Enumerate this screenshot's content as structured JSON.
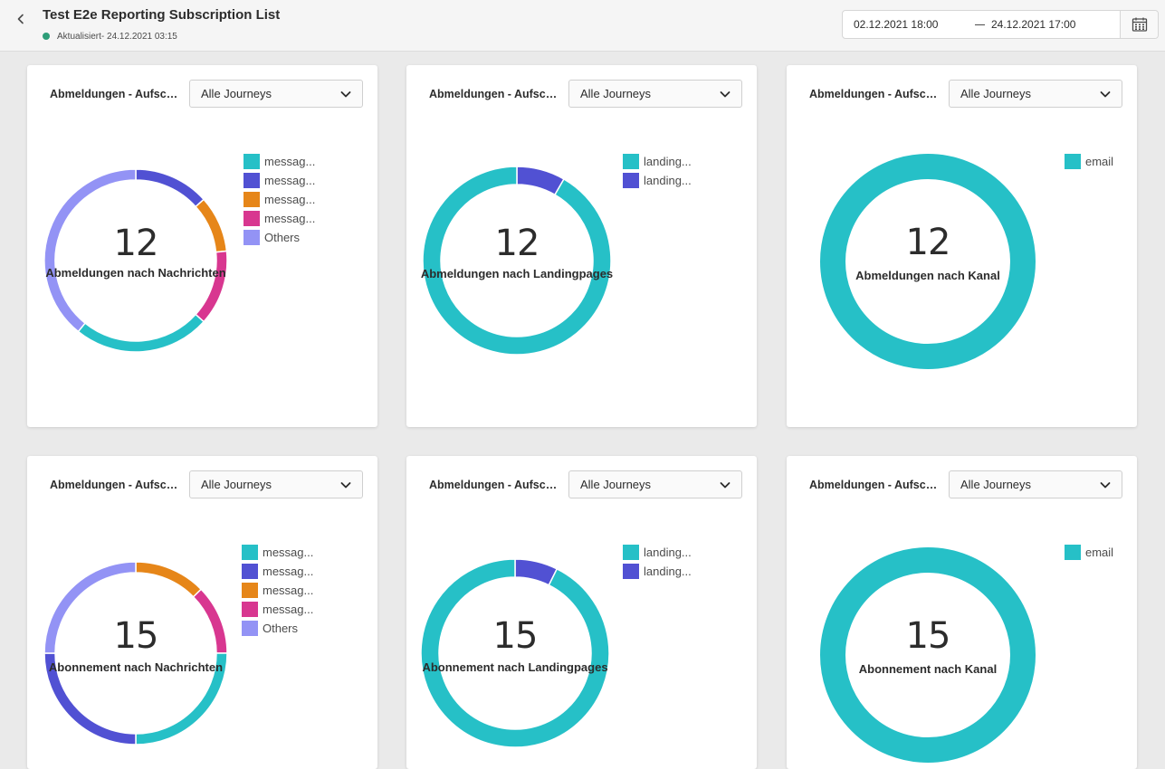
{
  "header": {
    "title": "Test E2e Reporting Subscription List",
    "status": "Aktualisiert- 24.12.2021 03:15",
    "status_color": "#2d9d78",
    "back_icon": "chevron-left-icon"
  },
  "date_range": {
    "start": "02.12.2021 18:00",
    "end": "24.12.2021 17:00",
    "calendar_icon": "calendar-icon"
  },
  "colors": {
    "teal": "#26c0c7",
    "indigo": "#5151d3",
    "orange": "#e68619",
    "magenta": "#d83790",
    "lavender": "#9393f5"
  },
  "cards": [
    {
      "title": "Abmeldungen - Aufschlüsselung",
      "dropdown": "Alle Journeys",
      "chart_data": {
        "type": "pie",
        "total": "12",
        "center_label": "Abmeldungen nach Nachrichten",
        "slices": [
          {
            "label": "messag...",
            "value": 1.6,
            "color": "#5151d3"
          },
          {
            "label": "messag...",
            "value": 1.2,
            "color": "#e68619"
          },
          {
            "label": "messag...",
            "value": 1.6,
            "color": "#d83790"
          },
          {
            "label": "",
            "value": 2.9,
            "color": "#26c0c7"
          },
          {
            "label": "Others",
            "value": 4.7,
            "color": "#9393f5"
          }
        ],
        "legend": [
          {
            "label": "messag...",
            "color": "#26c0c7"
          },
          {
            "label": "messag...",
            "color": "#5151d3"
          },
          {
            "label": "messag...",
            "color": "#e68619"
          },
          {
            "label": "messag...",
            "color": "#d83790"
          },
          {
            "label": "Others",
            "color": "#9393f5"
          }
        ]
      }
    },
    {
      "title": "Abmeldungen - Aufschlüsselung",
      "dropdown": "Alle Journeys",
      "chart_data": {
        "type": "pie",
        "total": "12",
        "center_label": "Abmeldungen nach Landingpages",
        "slices": [
          {
            "label": "landing...",
            "value": 1,
            "color": "#5151d3"
          },
          {
            "label": "landing...",
            "value": 11,
            "color": "#26c0c7"
          }
        ],
        "legend": [
          {
            "label": "landing...",
            "color": "#26c0c7"
          },
          {
            "label": "landing...",
            "color": "#5151d3"
          }
        ]
      }
    },
    {
      "title": "Abmeldungen - Aufschlüsselung",
      "dropdown": "Alle Journeys",
      "chart_data": {
        "type": "pie",
        "total": "12",
        "center_label": "Abmeldungen nach Kanal",
        "slices": [
          {
            "label": "email",
            "value": 12,
            "color": "#26c0c7"
          }
        ],
        "legend": [
          {
            "label": "email",
            "color": "#26c0c7"
          }
        ]
      }
    },
    {
      "title": "Abmeldungen - Aufschlüsselung",
      "dropdown": "Alle Journeys",
      "chart_data": {
        "type": "pie",
        "total": "15",
        "center_label": "Abonnement nach Nachrichten",
        "slices": [
          {
            "label": "messag...",
            "value": 1.9,
            "color": "#e68619"
          },
          {
            "label": "messag...",
            "value": 1.85,
            "color": "#d83790"
          },
          {
            "label": "messag...",
            "value": 3.75,
            "color": "#26c0c7"
          },
          {
            "label": "messag...",
            "value": 3.75,
            "color": "#5151d3"
          },
          {
            "label": "Others",
            "value": 3.75,
            "color": "#9393f5"
          }
        ],
        "legend": [
          {
            "label": "messag...",
            "color": "#26c0c7"
          },
          {
            "label": "messag...",
            "color": "#5151d3"
          },
          {
            "label": "messag...",
            "color": "#e68619"
          },
          {
            "label": "messag...",
            "color": "#d83790"
          },
          {
            "label": "Others",
            "color": "#9393f5"
          }
        ]
      }
    },
    {
      "title": "Abmeldungen - Aufschlüsselung",
      "dropdown": "Alle Journeys",
      "chart_data": {
        "type": "pie",
        "total": "15",
        "center_label": "Abonnement nach Landingpages",
        "slices": [
          {
            "label": "landing...",
            "value": 1.1,
            "color": "#5151d3"
          },
          {
            "label": "landing...",
            "value": 13.9,
            "color": "#26c0c7"
          }
        ],
        "legend": [
          {
            "label": "landing...",
            "color": "#26c0c7"
          },
          {
            "label": "landing...",
            "color": "#5151d3"
          }
        ]
      }
    },
    {
      "title": "Abmeldungen - Aufschlüsselung",
      "dropdown": "Alle Journeys",
      "chart_data": {
        "type": "pie",
        "total": "15",
        "center_label": "Abonnement nach Kanal",
        "slices": [
          {
            "label": "email",
            "value": 15,
            "color": "#26c0c7"
          }
        ],
        "legend": [
          {
            "label": "email",
            "color": "#26c0c7"
          }
        ]
      }
    }
  ]
}
